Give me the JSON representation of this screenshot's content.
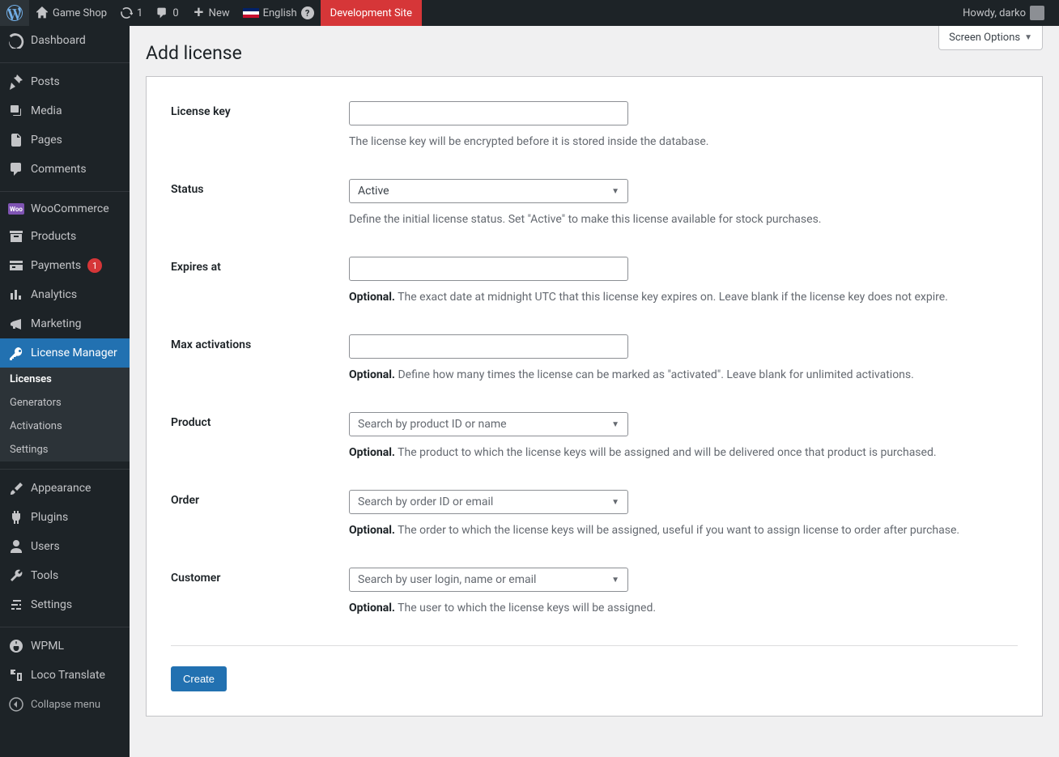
{
  "adminbar": {
    "site_name": "Game Shop",
    "updates": "1",
    "comments": "0",
    "new_label": "New",
    "lang": "English",
    "dev_site": "Development Site",
    "greeting": "Howdy, darko"
  },
  "sidebar": {
    "dashboard": "Dashboard",
    "posts": "Posts",
    "media": "Media",
    "pages": "Pages",
    "comments": "Comments",
    "woocommerce": "WooCommerce",
    "products": "Products",
    "payments": "Payments",
    "payments_badge": "1",
    "analytics": "Analytics",
    "marketing": "Marketing",
    "license_manager": "License Manager",
    "submenu": {
      "licenses": "Licenses",
      "generators": "Generators",
      "activations": "Activations",
      "settings": "Settings"
    },
    "appearance": "Appearance",
    "plugins": "Plugins",
    "users": "Users",
    "tools": "Tools",
    "settings": "Settings",
    "wpml": "WPML",
    "loco": "Loco Translate",
    "collapse": "Collapse menu"
  },
  "page": {
    "screen_options": "Screen Options",
    "title": "Add license"
  },
  "form": {
    "license_key": {
      "label": "License key",
      "help": "The license key will be encrypted before it is stored inside the database."
    },
    "status": {
      "label": "Status",
      "value": "Active",
      "help": "Define the initial license status. Set \"Active\" to make this license available for stock purchases."
    },
    "expires": {
      "label": "Expires at",
      "help_strong": "Optional.",
      "help": " The exact date at midnight UTC that this license key expires on. Leave blank if the license key does not expire."
    },
    "max_activations": {
      "label": "Max activations",
      "help_strong": "Optional.",
      "help": " Define how many times the license can be marked as \"activated\". Leave blank for unlimited activations."
    },
    "product": {
      "label": "Product",
      "placeholder": "Search by product ID or name",
      "help_strong": "Optional.",
      "help": " The product to which the license keys will be assigned and will be delivered once that product is purchased."
    },
    "order": {
      "label": "Order",
      "placeholder": "Search by order ID or email",
      "help_strong": "Optional.",
      "help": " The order to which the license keys will be assigned, useful if you want to assign license to order after purchase."
    },
    "customer": {
      "label": "Customer",
      "placeholder": "Search by user login, name or email",
      "help_strong": "Optional.",
      "help": " The user to which the license keys will be assigned."
    },
    "submit": "Create"
  }
}
